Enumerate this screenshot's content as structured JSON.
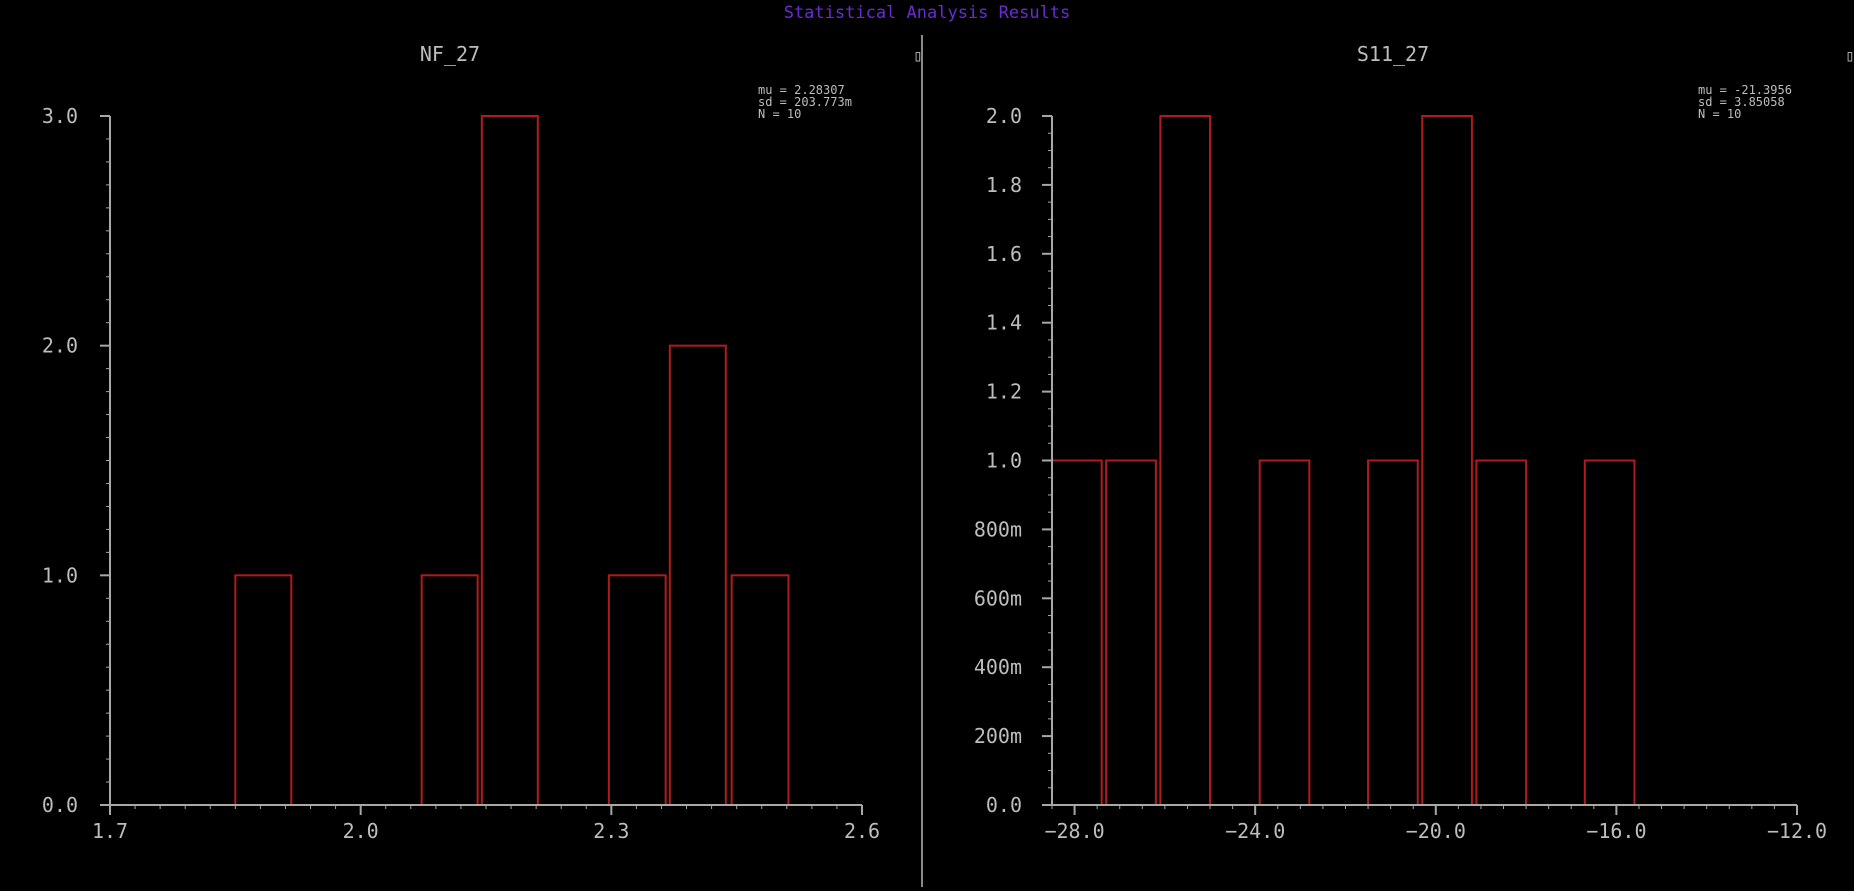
{
  "window_title": "Statistical Analysis Results",
  "colors": {
    "background": "#000000",
    "title": "#6a2bd6",
    "text": "#bdbdbd",
    "axis": "#a8a8a8",
    "bars": "#b01c1c",
    "divider": "#8a8a8a"
  },
  "chart_data": [
    {
      "type": "histogram",
      "title": "NF_27",
      "stats": [
        "mu = 2.28307",
        "sd = 203.773m",
        "N = 10"
      ],
      "xlim": [
        1.7,
        2.6
      ],
      "ylim": [
        0,
        3
      ],
      "x_ticks": [
        1.7,
        2.0,
        2.3,
        2.6
      ],
      "x_tick_labels": [
        "1.7",
        "2.0",
        "2.3",
        "2.6"
      ],
      "y_ticks": [
        0,
        1,
        2,
        3
      ],
      "y_tick_labels": [
        "0.0",
        "1.0",
        "2.0",
        "3.0"
      ],
      "y_minor_step": 0.1,
      "x_minor_step": 0.03,
      "bins": [
        {
          "x0": 1.85,
          "x1": 1.917,
          "count": 1
        },
        {
          "x0": 2.073,
          "x1": 2.14,
          "count": 1
        },
        {
          "x0": 2.145,
          "x1": 2.212,
          "count": 3
        },
        {
          "x0": 2.297,
          "x1": 2.365,
          "count": 1
        },
        {
          "x0": 2.37,
          "x1": 2.437,
          "count": 2
        },
        {
          "x0": 2.444,
          "x1": 2.512,
          "count": 1
        }
      ]
    },
    {
      "type": "histogram",
      "title": "S11_27",
      "stats": [
        "mu = -21.3956",
        "sd = 3.85058",
        "N = 10"
      ],
      "xlim": [
        -28.5,
        -12.0
      ],
      "ylim": [
        0,
        2
      ],
      "x_ticks": [
        -28,
        -24,
        -20,
        -16,
        -12
      ],
      "x_tick_labels": [
        "−28.0",
        "−24.0",
        "−20.0",
        "−16.0",
        "−12.0"
      ],
      "y_ticks": [
        0,
        0.2,
        0.4,
        0.6,
        0.8,
        1.0,
        1.2,
        1.4,
        1.6,
        1.8,
        2.0
      ],
      "y_tick_labels": [
        "0.0",
        "200m",
        "400m",
        "600m",
        "800m",
        "1.0",
        "1.2",
        "1.4",
        "1.6",
        "1.8",
        "2.0"
      ],
      "y_minor_step": 0.05,
      "x_minor_step": 0.5,
      "bins": [
        {
          "x0": -28.5,
          "x1": -27.4,
          "count": 1
        },
        {
          "x0": -27.3,
          "x1": -26.2,
          "count": 1
        },
        {
          "x0": -26.1,
          "x1": -25.0,
          "count": 2
        },
        {
          "x0": -23.9,
          "x1": -22.8,
          "count": 1
        },
        {
          "x0": -21.5,
          "x1": -20.4,
          "count": 1
        },
        {
          "x0": -20.3,
          "x1": -19.2,
          "count": 2
        },
        {
          "x0": -19.1,
          "x1": -18.0,
          "count": 1
        },
        {
          "x0": -16.7,
          "x1": -15.6,
          "count": 1
        }
      ]
    }
  ]
}
